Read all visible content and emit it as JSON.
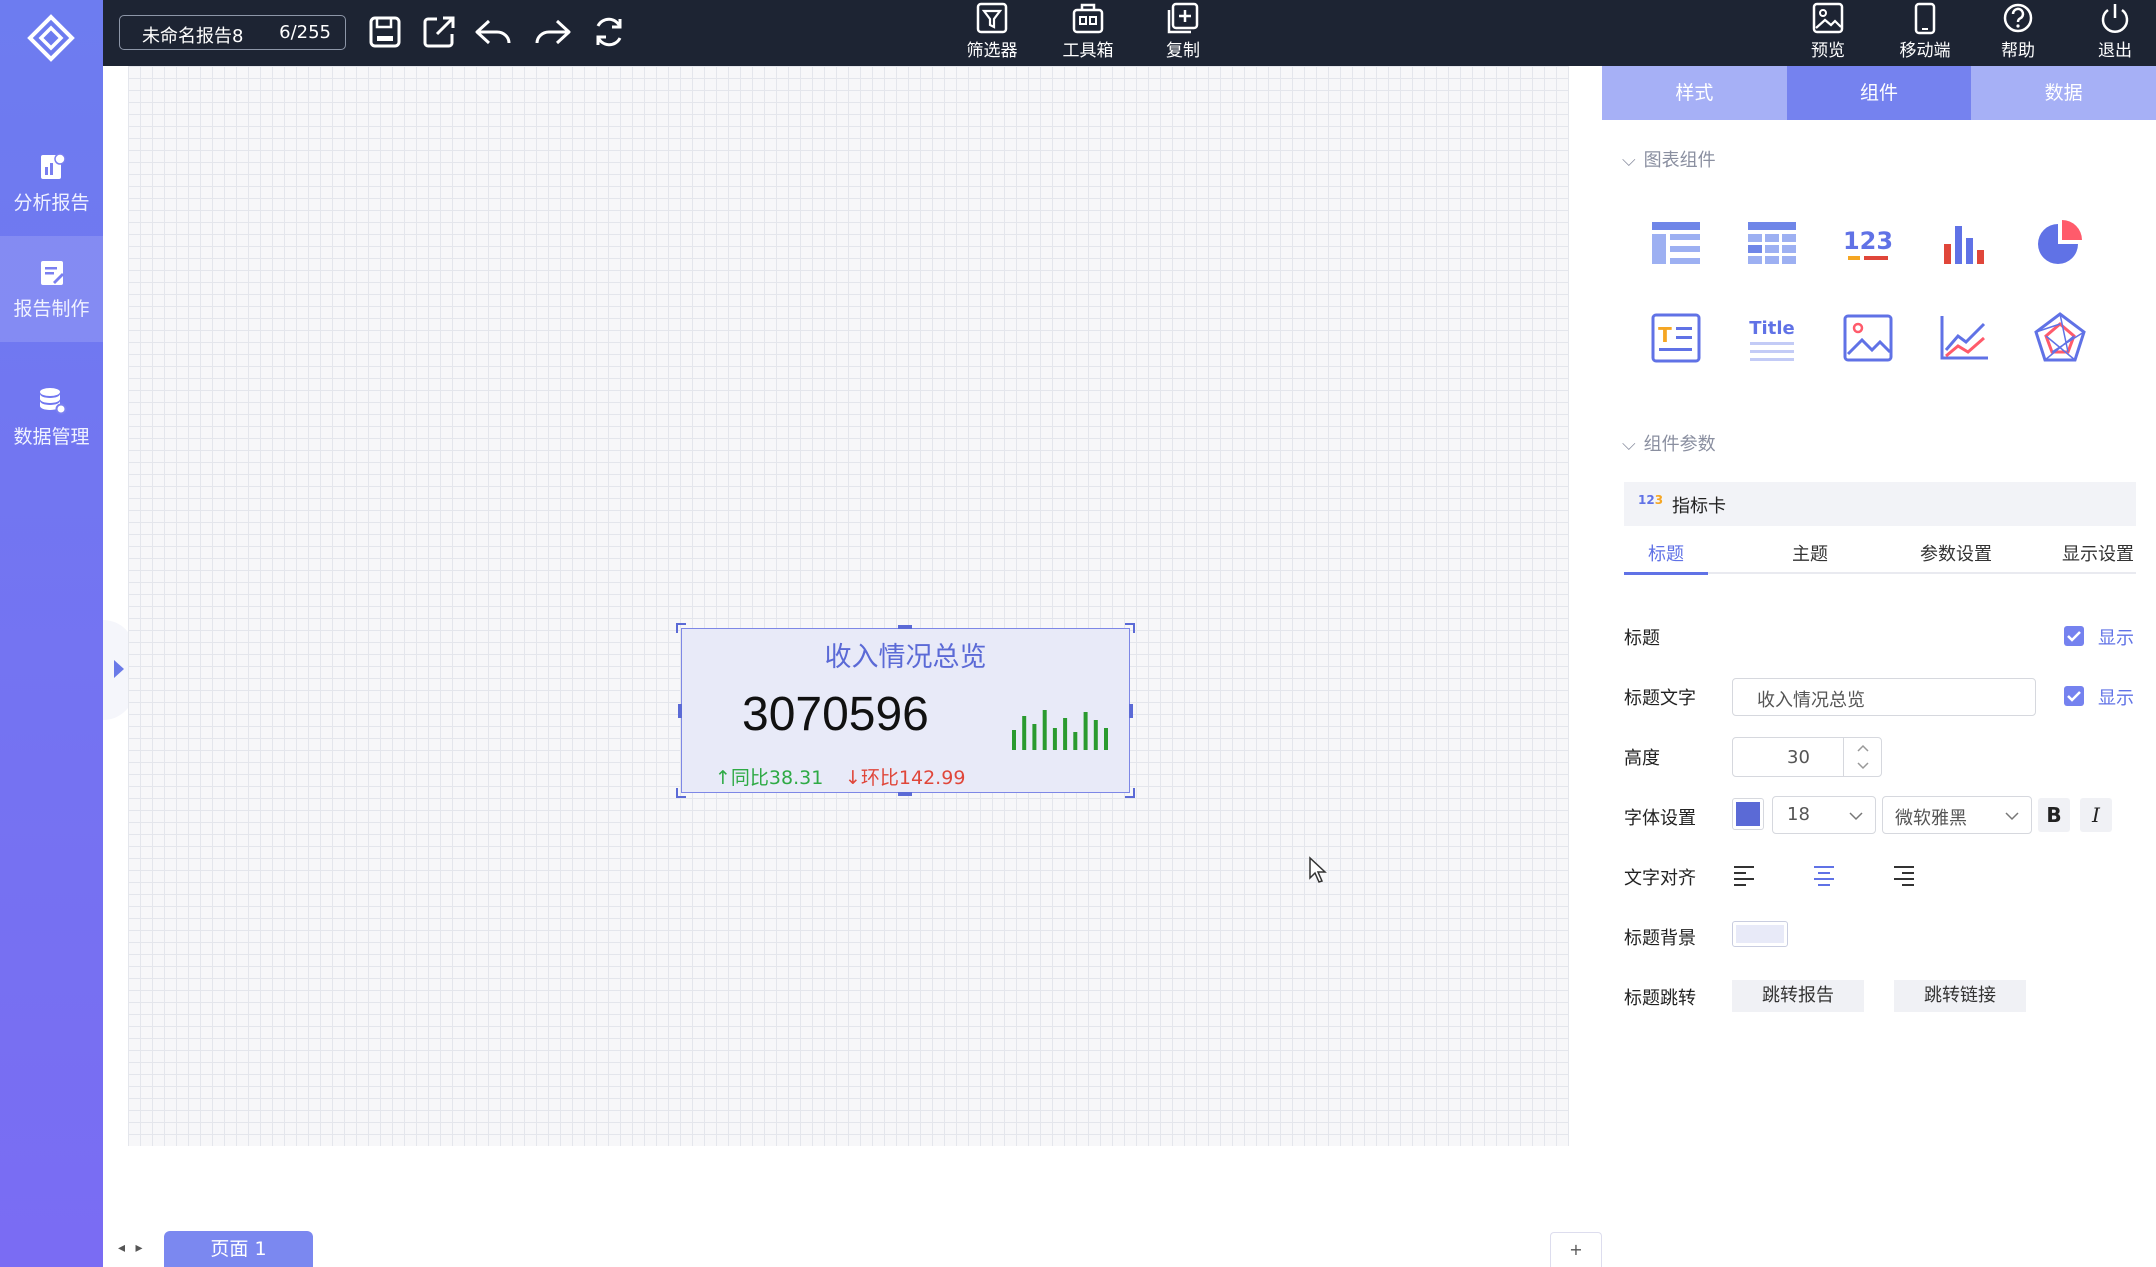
{
  "sidebar": {
    "items": [
      {
        "label": "分析报告",
        "icon": "report-chart-icon"
      },
      {
        "label": "报告制作",
        "icon": "report-edit-icon"
      },
      {
        "label": "数据管理",
        "icon": "database-gear-icon"
      }
    ],
    "active_index": 1
  },
  "topbar": {
    "report_name": "未命名报告8",
    "report_count": "6/255",
    "center_buttons": [
      {
        "label": "筛选器",
        "icon": "filter-icon"
      },
      {
        "label": "工具箱",
        "icon": "toolbox-icon"
      },
      {
        "label": "复制",
        "icon": "copy-add-icon"
      }
    ],
    "right_buttons": [
      {
        "label": "预览",
        "icon": "preview-image-icon"
      },
      {
        "label": "移动端",
        "icon": "mobile-icon"
      },
      {
        "label": "帮助",
        "icon": "help-icon"
      },
      {
        "label": "退出",
        "icon": "power-icon"
      }
    ]
  },
  "card": {
    "title": "收入情况总览",
    "value": "3070596",
    "yoy": "同比38.31",
    "mom": "环比142.99",
    "mini_bars": [
      0.5,
      0.85,
      0.65,
      1.0,
      0.55,
      0.8,
      0.45,
      0.95,
      0.75,
      0.55
    ],
    "title_color": "#5b6ad6",
    "yoy_color": "#2eaa45",
    "mom_color": "#e0463a",
    "bar_color": "#2a9a2f"
  },
  "pages": {
    "tab": "页面 1",
    "add": "+"
  },
  "panel": {
    "tabs": [
      "样式",
      "组件",
      "数据"
    ],
    "active_tab": 1,
    "section_components": "图表组件",
    "section_params": "组件参数",
    "components": [
      "table-icon",
      "grid-table-icon",
      "number-card-icon",
      "bar-chart-icon",
      "pie-chart-icon",
      "text-icon",
      "title-icon",
      "image-icon",
      "line-chart-icon",
      "radar-chart-icon"
    ],
    "component_name": "指标卡",
    "sub_tabs": [
      "标题",
      "主题",
      "参数设置",
      "显示设置"
    ],
    "rows": {
      "title_label": "标题",
      "title_show": "显示",
      "title_text_label": "标题文字",
      "title_text_value": "收入情况总览",
      "title_text_show": "显示",
      "height_label": "高度",
      "height_value": "30",
      "font_label": "字体设置",
      "font_size": "18",
      "font_family": "微软雅黑",
      "font_color": "#5b6ad6",
      "align_label": "文字对齐",
      "bg_label": "标题背景",
      "bg_color": "#e8eaf8",
      "jump_label": "标题跳转",
      "jump_report": "跳转报告",
      "jump_link": "跳转链接"
    }
  }
}
